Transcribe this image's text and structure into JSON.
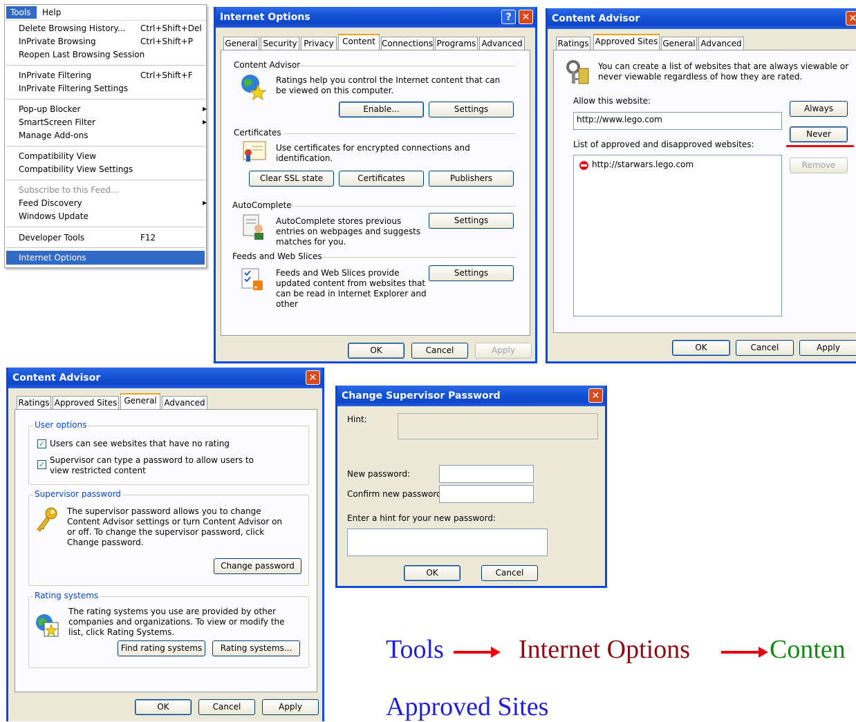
{
  "tools_menu": {
    "menubar": {
      "tools": "Tools",
      "help": "Help"
    },
    "items": [
      {
        "label": "Delete Browsing History...",
        "shortcut": "Ctrl+Shift+Del"
      },
      {
        "label": "InPrivate Browsing",
        "shortcut": "Ctrl+Shift+P"
      },
      {
        "label": "Reopen Last Browsing Session",
        "shortcut": ""
      },
      {
        "label": "InPrivate Filtering",
        "shortcut": "Ctrl+Shift+F"
      },
      {
        "label": "InPrivate Filtering Settings",
        "shortcut": ""
      },
      {
        "label": "Pop-up Blocker",
        "shortcut": ""
      },
      {
        "label": "SmartScreen Filter",
        "shortcut": ""
      },
      {
        "label": "Manage Add-ons",
        "shortcut": ""
      },
      {
        "label": "Compatibility View",
        "shortcut": ""
      },
      {
        "label": "Compatibility View Settings",
        "shortcut": ""
      },
      {
        "label": "Subscribe to this Feed...",
        "shortcut": ""
      },
      {
        "label": "Feed Discovery",
        "shortcut": ""
      },
      {
        "label": "Windows Update",
        "shortcut": ""
      },
      {
        "label": "Developer Tools",
        "shortcut": "F12"
      },
      {
        "label": "Internet Options",
        "shortcut": ""
      }
    ]
  },
  "internet_options": {
    "title": "Internet Options",
    "tabs": [
      "General",
      "Security",
      "Privacy",
      "Content",
      "Connections",
      "Programs",
      "Advanced"
    ],
    "active_tab": "Content",
    "content_advisor": {
      "heading": "Content Advisor",
      "text": "Ratings help you control the Internet content that can be viewed on this computer.",
      "enable": "Enable...",
      "settings": "Settings"
    },
    "certificates": {
      "heading": "Certificates",
      "text": "Use certificates for encrypted connections and identification.",
      "clear_ssl": "Clear SSL state",
      "certificates": "Certificates",
      "publishers": "Publishers"
    },
    "autocomplete": {
      "heading": "AutoComplete",
      "text": "AutoComplete stores previous entries on webpages and suggests matches for you.",
      "settings": "Settings"
    },
    "feeds": {
      "heading": "Feeds and Web Slices",
      "text": "Feeds and Web Slices provide updated content from websites that can be read in Internet Explorer and other",
      "settings": "Settings"
    },
    "buttons": {
      "ok": "OK",
      "cancel": "Cancel",
      "apply": "Apply"
    }
  },
  "content_advisor_approved": {
    "title": "Content Advisor",
    "tabs": [
      "Ratings",
      "Approved Sites",
      "General",
      "Advanced"
    ],
    "active_tab": "Approved Sites",
    "description": "You can create a list of websites that are always viewable or never viewable regardless of how they are rated.",
    "allow_label": "Allow this website:",
    "allow_value": "http://www.lego.com",
    "always": "Always",
    "never": "Never",
    "list_label": "List of approved and disapproved websites:",
    "sites": [
      "http://starwars.lego.com"
    ],
    "remove": "Remove",
    "buttons": {
      "ok": "OK",
      "cancel": "Cancel",
      "apply": "Apply"
    }
  },
  "content_advisor_general": {
    "title": "Content Advisor",
    "tabs": [
      "Ratings",
      "Approved Sites",
      "General",
      "Advanced"
    ],
    "active_tab": "General",
    "user_options": {
      "heading": "User options",
      "opt1": "Users can see websites that have no rating",
      "opt2": "Supervisor can type a password to allow users to view restricted content"
    },
    "supervisor_password": {
      "heading": "Supervisor password",
      "text": "The supervisor password allows you to change Content Advisor settings or turn Content Advisor on or off. To change the supervisor password, click Change password.",
      "change": "Change password"
    },
    "rating_systems": {
      "heading": "Rating systems",
      "text": "The rating systems you use are provided by other companies and organizations. To view or modify the list, click Rating Systems.",
      "find": "Find rating systems",
      "rating": "Rating systems..."
    },
    "buttons": {
      "ok": "OK",
      "cancel": "Cancel",
      "apply": "Apply"
    }
  },
  "change_password": {
    "title": "Change Supervisor Password",
    "hint_label": "Hint:",
    "new_label": "New password:",
    "confirm_label": "Confirm new password:",
    "enter_hint_label": "Enter a hint for your new password:",
    "ok": "OK",
    "cancel": "Cancel"
  },
  "caption": {
    "tools": "Tools",
    "internet_options": "Internet Options",
    "content": "Conten",
    "approved_sites": "Approved Sites",
    "colors": {
      "tools": "#1f1fd0",
      "internet_options": "#8b0b16",
      "content": "#128a12",
      "approved_sites": "#1f1fd0"
    }
  }
}
